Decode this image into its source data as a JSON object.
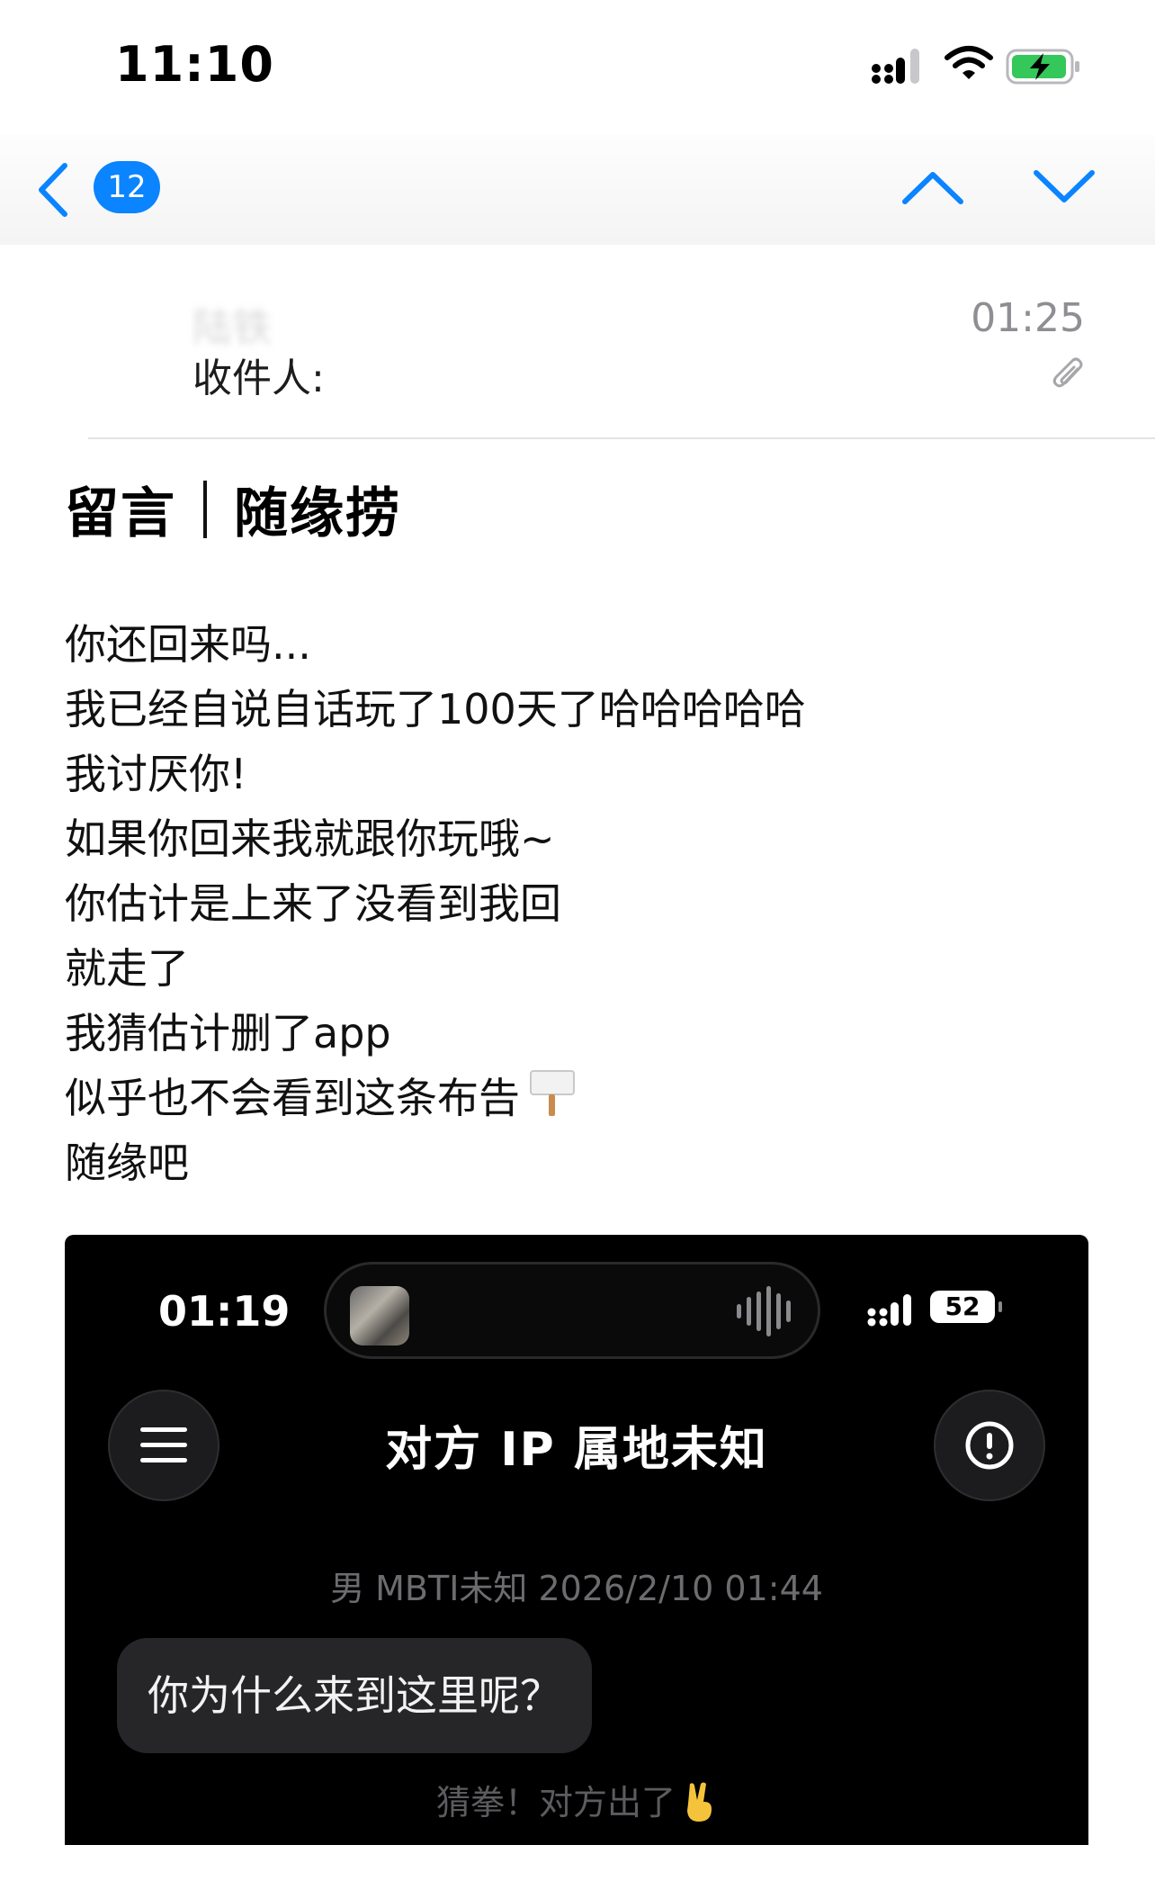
{
  "status_bar": {
    "time": "11:10"
  },
  "nav": {
    "unread_count": "12"
  },
  "mail": {
    "sender": "陆铁",
    "recipient_label": "收件人:",
    "time": "01:25",
    "subject_left": "留言",
    "subject_right": "随缘捞",
    "body": [
      "你还回来吗...",
      "我已经自说自话玩了100天了哈哈哈哈哈",
      "我讨厌你!",
      "如果你回来我就跟你玩哦~",
      "你估计是上来了没看到我回",
      "就走了",
      "我猜估计删了app",
      "似乎也不会看到这条布告",
      "随缘吧"
    ]
  },
  "embedded_screenshot": {
    "time": "01:19",
    "battery": "52",
    "title": "对方 IP 属地未知",
    "meta": "男 MBTI未知 2026/2/10 01:44",
    "message": "你为什么来到这里呢？",
    "game_text": "猜拳！对方出了"
  },
  "icons": {
    "back": "chevron-left-icon",
    "up": "chevron-up-icon",
    "down": "chevron-down-icon",
    "attachment": "paperclip-icon",
    "signpost": "placard-icon",
    "victory": "victory-hand-icon"
  },
  "colors": {
    "accent": "#0a84ff",
    "battery_charging": "#34c759"
  }
}
